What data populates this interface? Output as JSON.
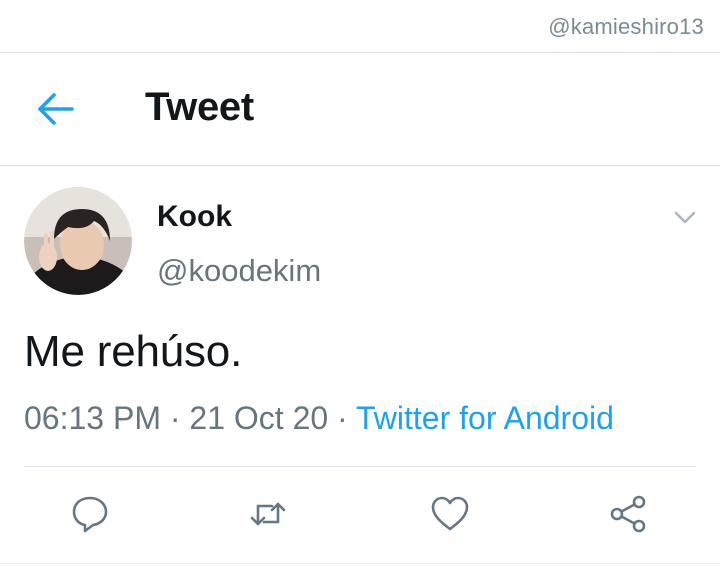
{
  "watermark": "@kamieshiro13",
  "header": {
    "title": "Tweet",
    "back_icon": "arrow-left-icon"
  },
  "tweet": {
    "author_name": "Kook",
    "author_handle": "@koodekim",
    "text": "Me rehúso.",
    "time": "06:13 PM",
    "separator": " · ",
    "date": "21 Oct 20",
    "source": "Twitter for Android"
  },
  "actions": {
    "reply_icon": "reply-icon",
    "retweet_icon": "retweet-icon",
    "like_icon": "heart-icon",
    "share_icon": "share-icon"
  },
  "colors": {
    "accent": "#1da1f2",
    "secondary_text": "#66757f",
    "primary_text": "#14171a",
    "divider": "#d6dde3"
  }
}
